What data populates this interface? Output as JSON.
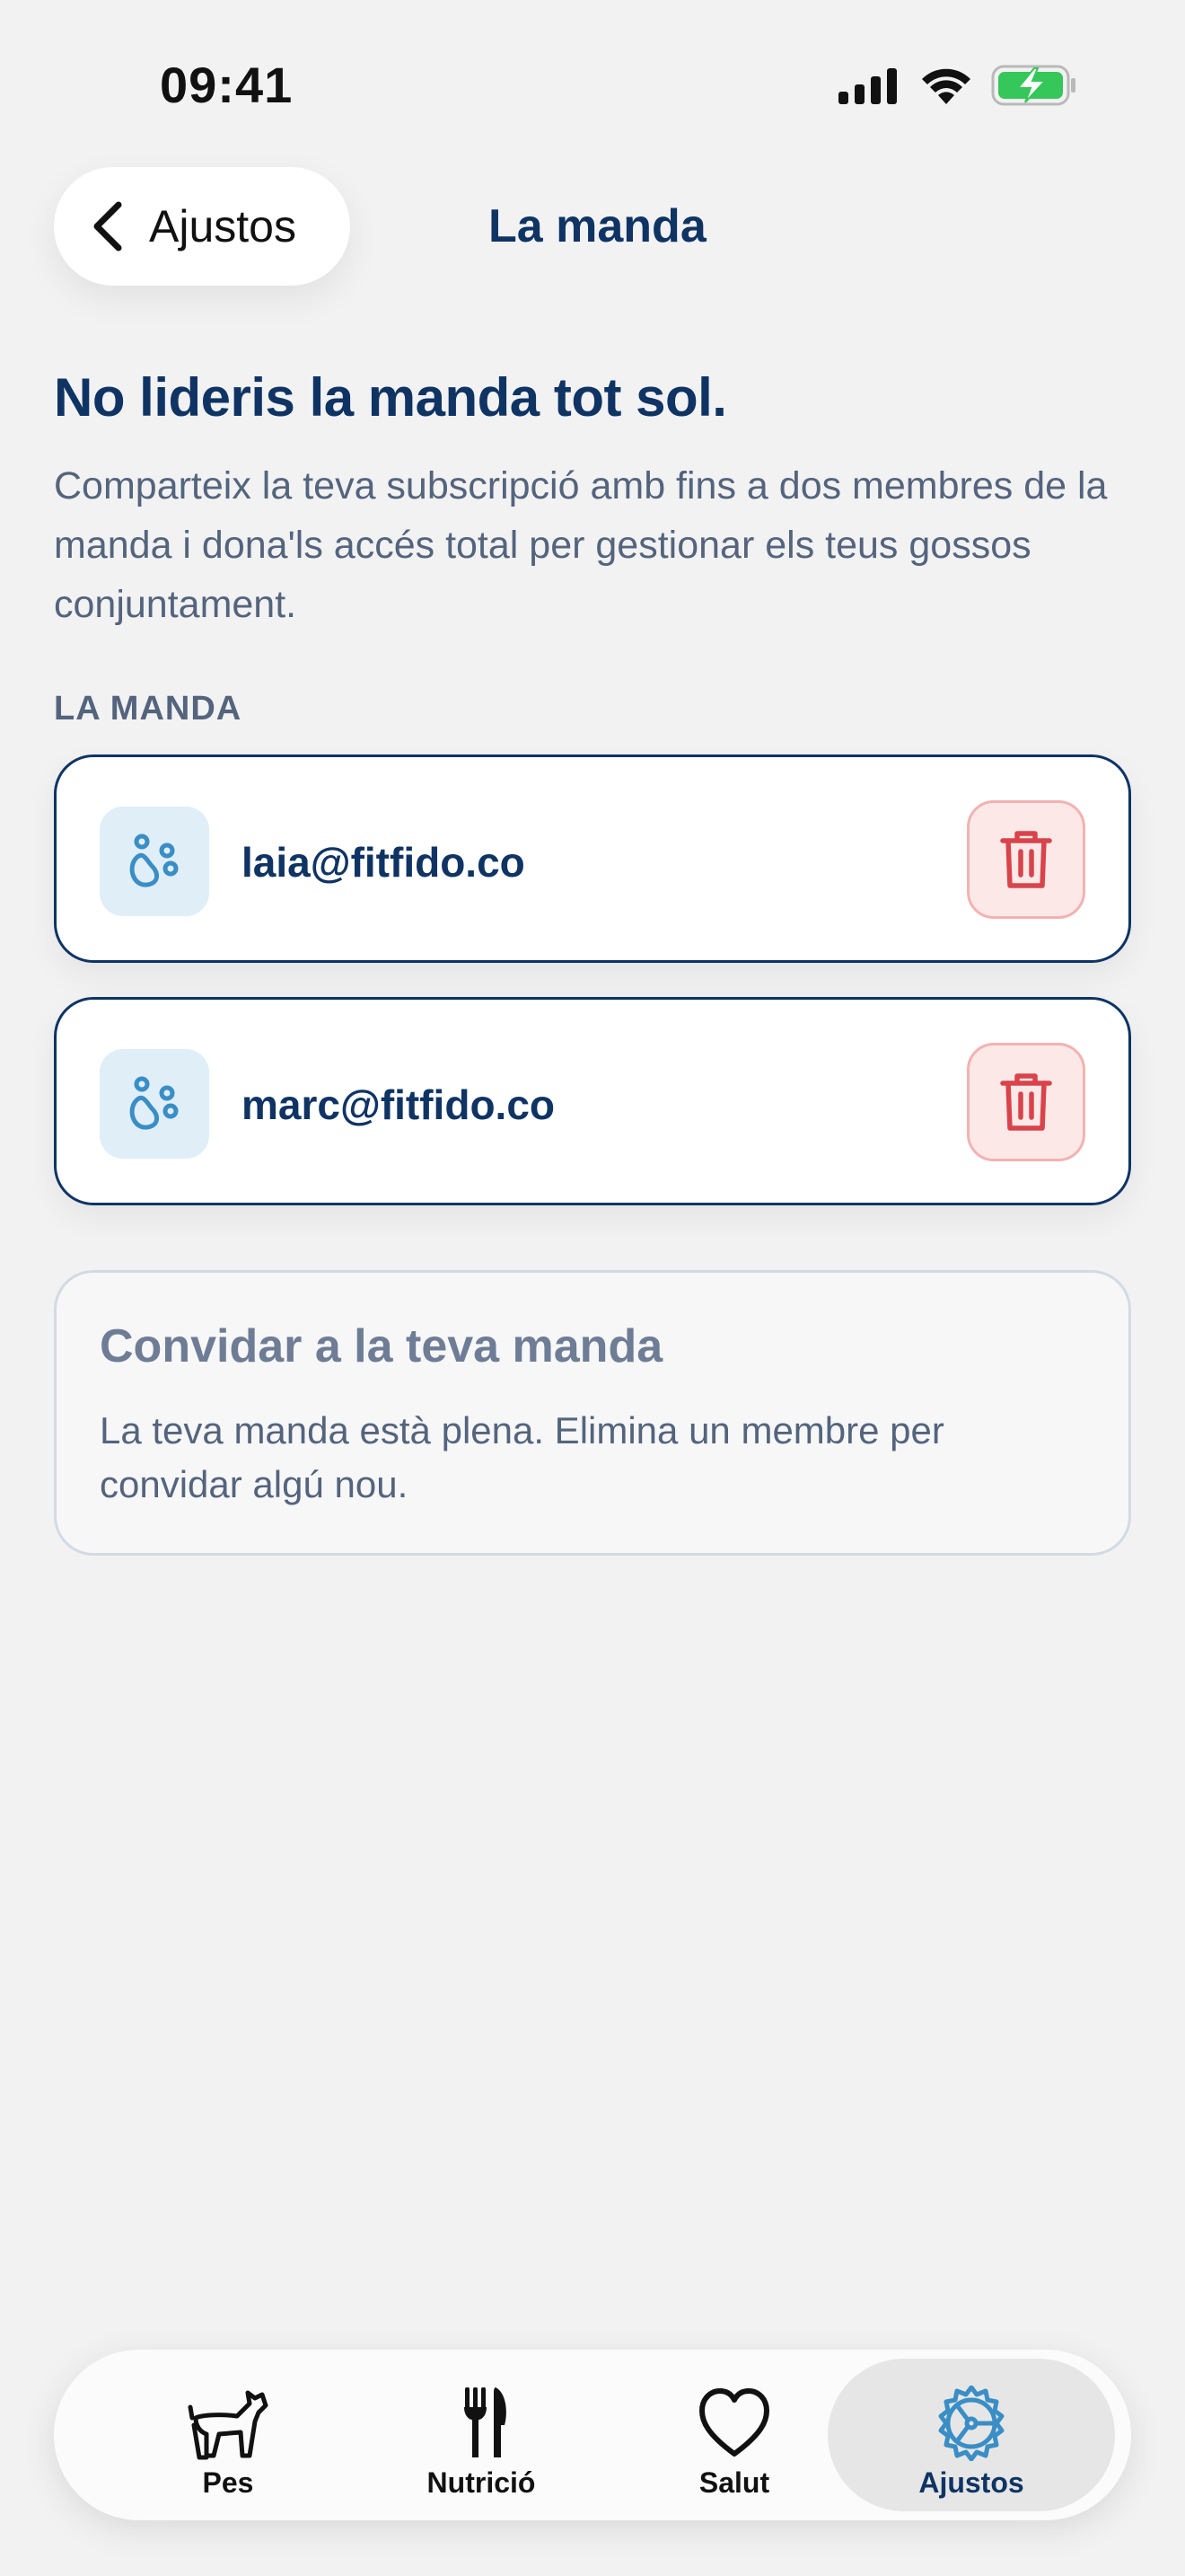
{
  "status_bar": {
    "time": "09:41"
  },
  "nav": {
    "back_label": "Ajustos",
    "title": "La manda"
  },
  "hero": {
    "heading": "No lideris la manda tot sol.",
    "description": "Comparteix la teva subscripció amb fins a dos membres de la manda i dona'ls accés total per gestionar els teus gossos conjuntament."
  },
  "members": {
    "section_label": "LA MANDA",
    "items": [
      {
        "email": "laia@fitfido.co"
      },
      {
        "email": "marc@fitfido.co"
      }
    ]
  },
  "invite": {
    "title": "Convidar a la teva manda",
    "text": "La teva manda està plena. Elimina un membre per convidar algú nou."
  },
  "tabs": [
    {
      "label": "Pes",
      "icon": "dog-icon"
    },
    {
      "label": "Nutrició",
      "icon": "fork-knife-icon"
    },
    {
      "label": "Salut",
      "icon": "heart-icon"
    },
    {
      "label": "Ajustos",
      "icon": "gear-icon",
      "active": true
    }
  ],
  "colors": {
    "primary": "#0f3464",
    "accent_blue": "#3a8ec5",
    "danger": "#d9434a",
    "danger_bg": "#fde8e8",
    "background": "#f2f2f3"
  }
}
